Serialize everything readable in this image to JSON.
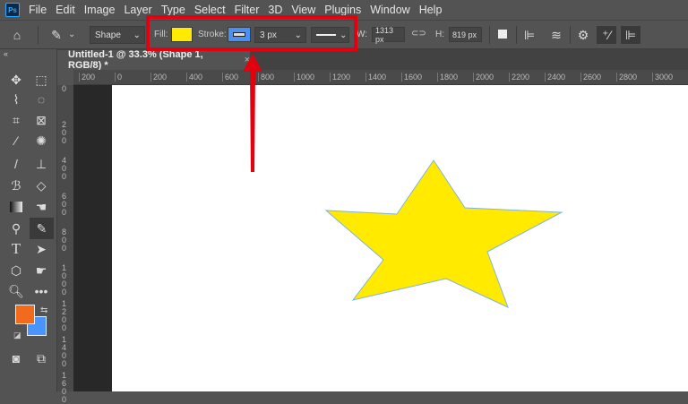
{
  "menu": {
    "items": [
      "File",
      "Edit",
      "Image",
      "Layer",
      "Type",
      "Select",
      "Filter",
      "3D",
      "View",
      "Plugins",
      "Window",
      "Help"
    ]
  },
  "options": {
    "tool_mode": "Shape",
    "fill_label": "Fill:",
    "fill_color": "#ffea00",
    "stroke_label": "Stroke:",
    "stroke_color": "#4a90f0",
    "stroke_width": "3 px",
    "w_label": "W:",
    "w_value": "1313 px",
    "h_label": "H:",
    "h_value": "819 px"
  },
  "document": {
    "tab_title": "Untitled-1 @ 33.3% (Shape 1, RGB/8) *",
    "close": "×"
  },
  "rulers": {
    "horizontal": [
      "200",
      "0",
      "200",
      "400",
      "600",
      "800",
      "1000",
      "1200",
      "1400",
      "1600",
      "1800",
      "2000",
      "2200",
      "2400",
      "2600",
      "2800",
      "3000"
    ],
    "vertical": [
      "0",
      "200",
      "400",
      "600",
      "800",
      "1000",
      "1200",
      "1400",
      "1600"
    ]
  },
  "colors": {
    "foreground": "#f26b1d",
    "background": "#4a94ff",
    "highlight": "#e3000f",
    "star_fill": "#ffea00",
    "star_stroke": "#7fb3e0"
  }
}
